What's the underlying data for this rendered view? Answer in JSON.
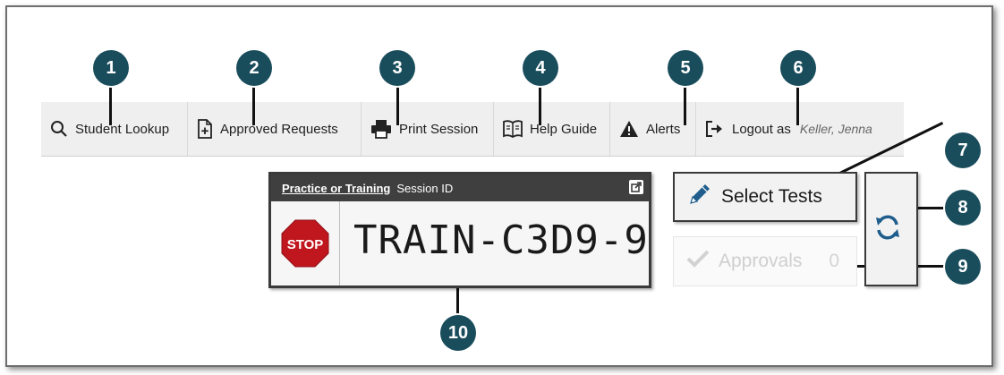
{
  "navbar": {
    "items": [
      {
        "label": "Student Lookup",
        "icon": "search-icon"
      },
      {
        "label": "Approved Requests",
        "icon": "document-plus-icon"
      },
      {
        "label": "Print Session",
        "icon": "printer-icon"
      },
      {
        "label": "Help Guide",
        "icon": "book-icon"
      },
      {
        "label": "Alerts",
        "icon": "warning-icon"
      },
      {
        "label": "Logout as",
        "icon": "logout-icon",
        "user": "Keller, Jenna"
      }
    ]
  },
  "callouts": [
    "1",
    "2",
    "3",
    "4",
    "5",
    "6",
    "7",
    "8",
    "9",
    "10"
  ],
  "session": {
    "mode_link": "Practice or Training",
    "id_label": "Session ID",
    "session_id": "TRAIN-C3D9-9",
    "stop_text": "STOP"
  },
  "actions": {
    "select_tests": "Select Tests",
    "approvals": "Approvals",
    "approvals_count": "0"
  },
  "colors": {
    "callout": "#1a4d5c",
    "navbar": "#efefef",
    "stop_red": "#c0171f",
    "accent_blue": "#1f5d8c"
  }
}
